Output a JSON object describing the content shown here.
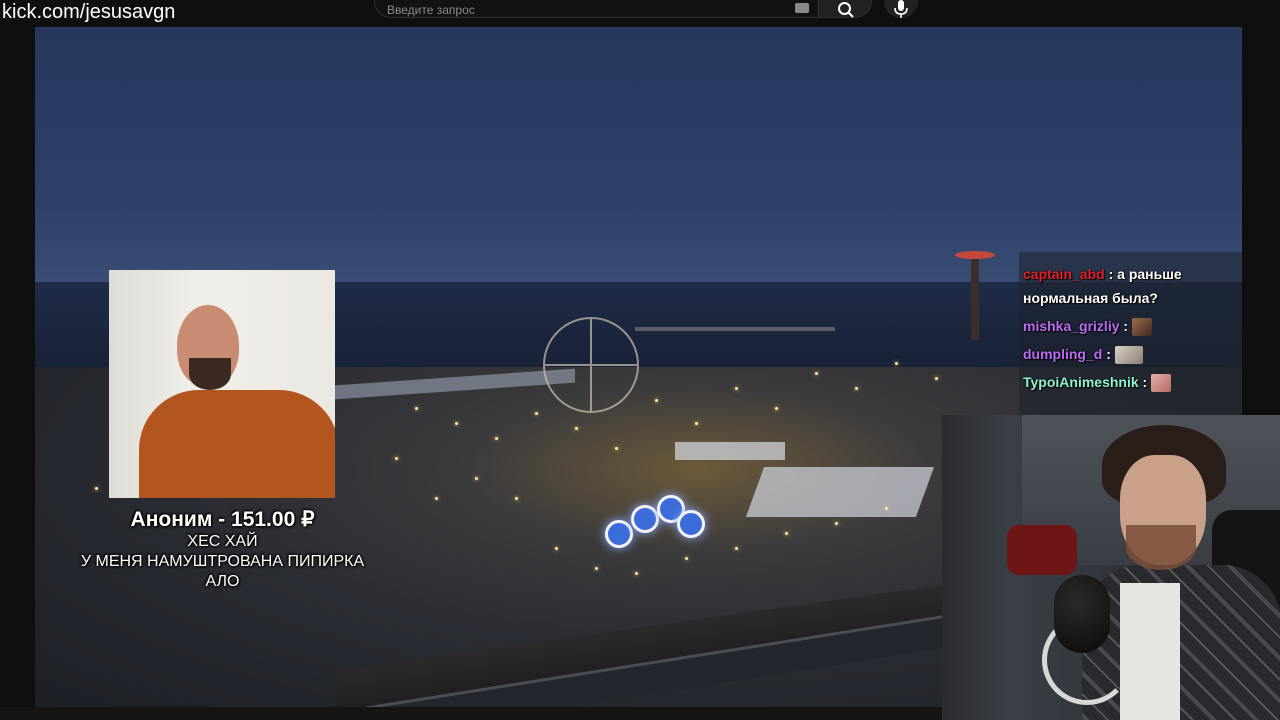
{
  "watermark": {
    "text": "kick.com/jesusavgn"
  },
  "search": {
    "placeholder": "Введите запрос"
  },
  "donation": {
    "title": "Аноним - 151.00 ₽",
    "lines": [
      "ХЕС ХАЙ",
      "У МЕНЯ НАМУШТРОВАНА ПИПИРКА",
      "АЛО"
    ]
  },
  "chat": {
    "messages": [
      {
        "user": "captain_abd",
        "color": "#e0202a",
        "separator": ":",
        "text": "а раньше"
      },
      {
        "user": "",
        "color": "#ffffff",
        "separator": "",
        "text": "нормальная была?"
      },
      {
        "user": "mishka_grizliy",
        "color": "#b96cf0",
        "separator": ":",
        "text": ""
      },
      {
        "user": "dumpling_d",
        "color": "#b96cf0",
        "separator": ":",
        "text": ""
      },
      {
        "user": "TypoiAnimeshnik",
        "color": "#8ff2d0",
        "separator": ":",
        "text": ""
      }
    ]
  }
}
